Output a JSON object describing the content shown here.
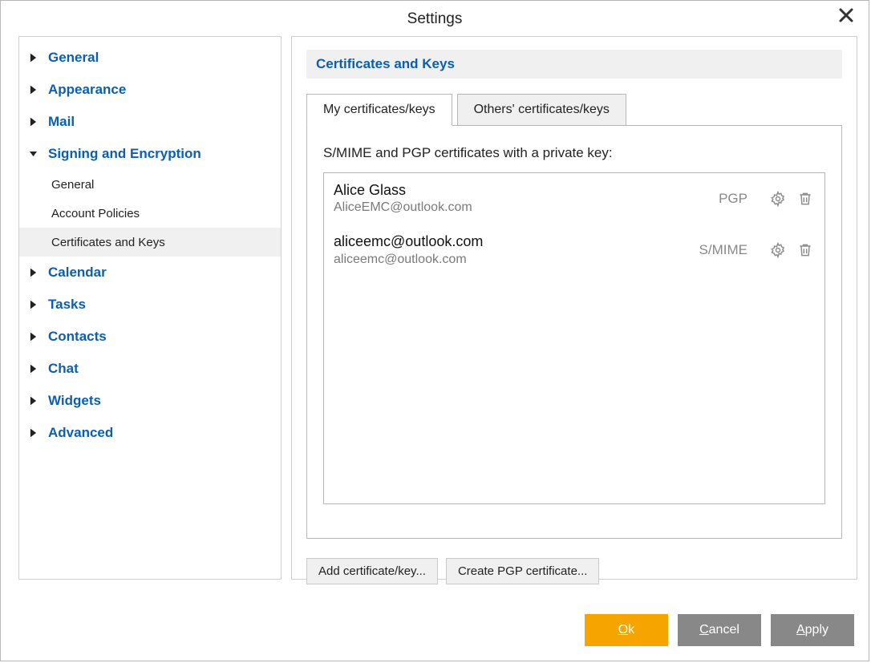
{
  "dialog": {
    "title": "Settings"
  },
  "sidebar": {
    "items": [
      {
        "label": "General",
        "expanded": false,
        "children": []
      },
      {
        "label": "Appearance",
        "expanded": false,
        "children": []
      },
      {
        "label": "Mail",
        "expanded": false,
        "children": []
      },
      {
        "label": "Signing and Encryption",
        "expanded": true,
        "children": [
          {
            "label": "General",
            "selected": false
          },
          {
            "label": "Account Policies",
            "selected": false
          },
          {
            "label": "Certificates and Keys",
            "selected": true
          }
        ]
      },
      {
        "label": "Calendar",
        "expanded": false,
        "children": []
      },
      {
        "label": "Tasks",
        "expanded": false,
        "children": []
      },
      {
        "label": "Contacts",
        "expanded": false,
        "children": []
      },
      {
        "label": "Chat",
        "expanded": false,
        "children": []
      },
      {
        "label": "Widgets",
        "expanded": false,
        "children": []
      },
      {
        "label": "Advanced",
        "expanded": false,
        "children": []
      }
    ]
  },
  "panel": {
    "heading": "Certificates and Keys",
    "tabs": [
      {
        "label": "My certificates/keys",
        "active": true
      },
      {
        "label": "Others' certificates/keys",
        "active": false
      }
    ],
    "description": "S/MIME and PGP certificates with a private key:",
    "certificates": [
      {
        "name": "Alice Glass",
        "email": "AliceEMC@outlook.com",
        "type": "PGP"
      },
      {
        "name": "aliceemc@outlook.com",
        "email": "aliceemc@outlook.com",
        "type": "S/MIME"
      }
    ],
    "buttons": {
      "add": "Add certificate/key...",
      "create": "Create PGP certificate..."
    }
  },
  "dialogButtons": {
    "ok_letter": "O",
    "ok_rest": "k",
    "cancel_letter": "C",
    "cancel_rest": "ancel",
    "apply_letter": "A",
    "apply_rest": "pply"
  }
}
